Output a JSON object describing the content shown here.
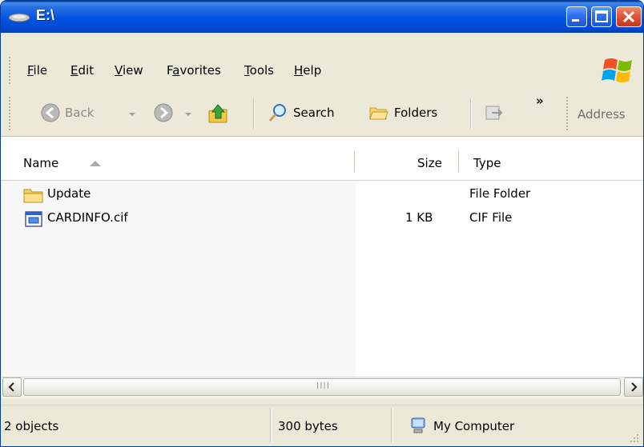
{
  "window": {
    "title": "E:\\"
  },
  "menu": [
    "File",
    "Edit",
    "View",
    "Favorites",
    "Tools",
    "Help"
  ],
  "menu_accel": [
    0,
    0,
    0,
    1,
    0,
    0
  ],
  "toolbar": {
    "back": "Back",
    "search": "Search",
    "folders": "Folders",
    "more": "»",
    "address": "Address"
  },
  "columns": {
    "name": "Name",
    "size": "Size",
    "type": "Type"
  },
  "files": [
    {
      "name": "Update",
      "size": "",
      "type": "File Folder",
      "icon": "folder-icon"
    },
    {
      "name": "CARDINFO.cif",
      "size": "1 KB",
      "type": "CIF File",
      "icon": "file-icon"
    }
  ],
  "status": {
    "objects": "2 objects",
    "bytes": "300 bytes",
    "location": "My Computer"
  },
  "scroll_grip": "IIII",
  "colors": {
    "titlebar": "#0054e3",
    "window_bg": "#ece9d8",
    "close": "#e2553a"
  }
}
